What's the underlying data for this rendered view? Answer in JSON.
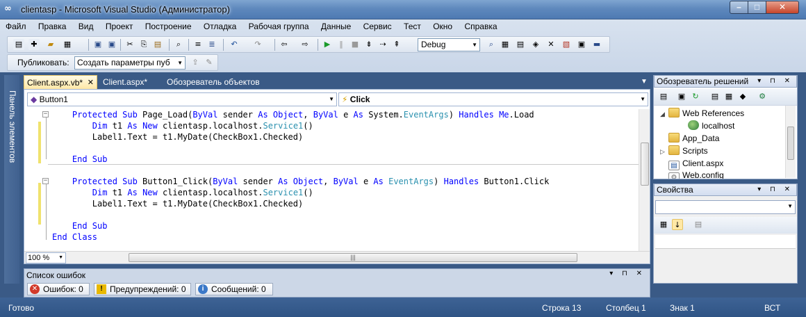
{
  "window": {
    "title": "clientasp - Microsoft Visual Studio (Администратор)",
    "app_icon": "visual-studio-icon"
  },
  "menu": [
    "Файл",
    "Правка",
    "Вид",
    "Проект",
    "Построение",
    "Отладка",
    "Рабочая группа",
    "Данные",
    "Сервис",
    "Тест",
    "Окно",
    "Справка"
  ],
  "toolbar": {
    "configuration": "Debug",
    "publish_label": "Публиковать:",
    "publish_value": "Создать параметры пуб"
  },
  "toolbox": {
    "label": "Панель элементов"
  },
  "editor": {
    "tabs": [
      {
        "label": "Client.aspx.vb*",
        "active": true
      },
      {
        "label": "Client.aspx*",
        "active": false
      },
      {
        "label": "Обозреватель объектов",
        "active": false
      }
    ],
    "nav_left": "Button1",
    "nav_right": "Click",
    "zoom": "100 %",
    "code": [
      "    Protected Sub Page_Load(ByVal sender As Object, ByVal e As System.EventArgs) Handles Me.Load",
      "        Dim t1 As New clientasp.localhost.Service1()",
      "        Label1.Text = t1.MyDate(CheckBox1.Checked)",
      "",
      "    End Sub",
      "",
      "    Protected Sub Button1_Click(ByVal sender As Object, ByVal e As EventArgs) Handles Button1.Click",
      "        Dim t1 As New clientasp.localhost.Service1()",
      "        Label1.Text = t1.MyDate(CheckBox1.Checked)",
      "",
      "    End Sub",
      "End Class"
    ]
  },
  "error_list": {
    "title": "Список ошибок",
    "tabs": [
      "Ошибок: 0",
      "Предупреждений: 0",
      "Сообщений: 0"
    ]
  },
  "solution_explorer": {
    "title": "Обозреватель решений",
    "items": [
      {
        "label": "Web References",
        "icon": "folder-icon"
      },
      {
        "label": "localhost",
        "icon": "web-reference-icon"
      },
      {
        "label": "App_Data",
        "icon": "folder-icon"
      },
      {
        "label": "Scripts",
        "icon": "folder-icon"
      },
      {
        "label": "Client.aspx",
        "icon": "aspx-file-icon"
      },
      {
        "label": "Web.config",
        "icon": "config-file-icon"
      }
    ]
  },
  "properties": {
    "title": "Свойства"
  },
  "status": {
    "ready": "Готово",
    "line": "Строка 13",
    "column": "Столбец 1",
    "char": "Знак 1",
    "mode": "ВСТ"
  }
}
